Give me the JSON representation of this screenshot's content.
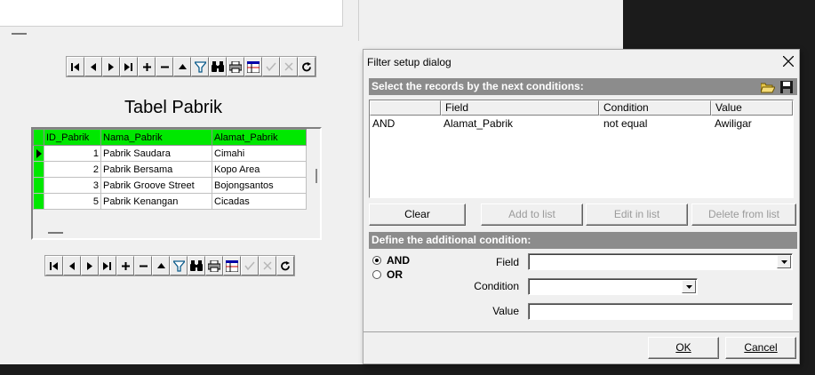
{
  "form": {
    "title": "Tabel Pabrik",
    "navigator_icons": [
      "first-icon",
      "prior-icon",
      "next-icon",
      "last-icon",
      "insert-icon",
      "delete-icon",
      "edit-icon",
      "filter-icon",
      "find-icon",
      "print-icon",
      "grid-icon",
      "post-icon",
      "cancel-icon",
      "refresh-icon"
    ],
    "grid": {
      "columns": [
        "ID_Pabrik",
        "Nama_Pabrik",
        "Alamat_Pabrik"
      ],
      "rows": [
        {
          "id": "1",
          "nama": "Pabrik Saudara",
          "alamat": "Cimahi"
        },
        {
          "id": "2",
          "nama": "Pabrik Bersama",
          "alamat": "Kopo Area"
        },
        {
          "id": "3",
          "nama": "Pabrik Groove Street",
          "alamat": "Bojongsantos"
        },
        {
          "id": "5",
          "nama": "Pabrik Kenangan",
          "alamat": "Cicadas"
        }
      ]
    }
  },
  "dialog": {
    "title": "Filter setup dialog",
    "records_band": "Select the records by the next conditions:",
    "list_columns": [
      "",
      "Field",
      "Condition",
      "Value"
    ],
    "conditions": [
      {
        "op": "AND",
        "field": "Alamat_Pabrik",
        "condition": "not equal",
        "value": "Awiligar"
      }
    ],
    "buttons": {
      "clear": "Clear",
      "add": "Add to list",
      "edit": "Edit in list",
      "delete": "Delete from list"
    },
    "define_band": "Define the additional condition:",
    "radio_and": "AND",
    "radio_or": "OR",
    "field_label": "Field",
    "condition_label": "Condition",
    "value_label": "Value",
    "field_value": "",
    "condition_value": "",
    "value_value": "",
    "ok_label": "OK",
    "cancel_label": "Cancel"
  }
}
